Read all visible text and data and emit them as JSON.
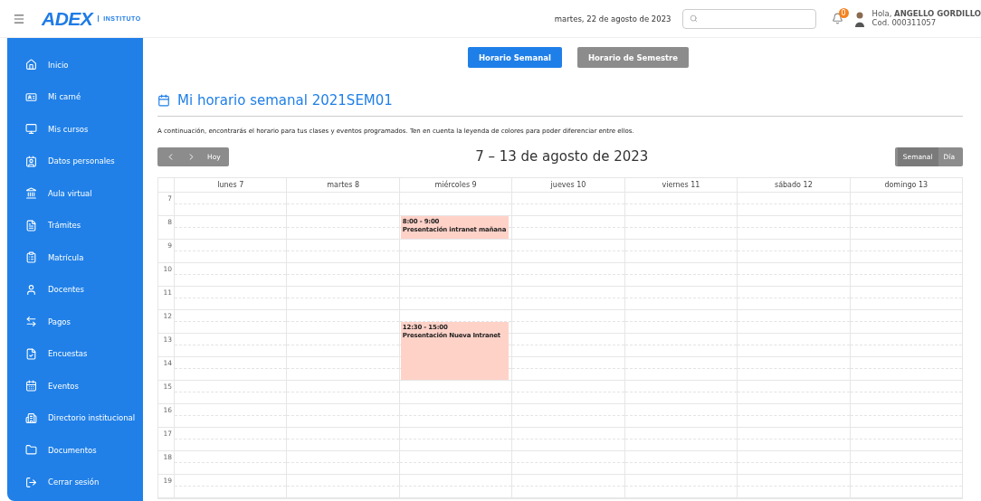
{
  "header": {
    "logo": "ADEX",
    "logo_sub": "INSTITUTO",
    "date": "martes, 22 de agosto de 2023",
    "notifications": {
      "badge": "0"
    },
    "user": {
      "greeting": "Hola, **ANGELLO GORDILLO**",
      "code": "Cod. 000311057"
    }
  },
  "sidebar": {
    "items": [
      {
        "label": "Inicio"
      },
      {
        "label": "Mi carné"
      },
      {
        "label": "Mis cursos"
      },
      {
        "label": "Datos personales"
      },
      {
        "label": "Aula virtual"
      },
      {
        "label": "Trámites"
      },
      {
        "label": "Matrícula"
      },
      {
        "label": "Docentes"
      },
      {
        "label": "Pagos"
      },
      {
        "label": "Encuestas"
      },
      {
        "label": "Eventos"
      },
      {
        "label": "Directorio institucional"
      },
      {
        "label": "Documentos"
      },
      {
        "label": "Cerrar sesión"
      }
    ]
  },
  "schedule_tabs": [
    {
      "label": "Horario Semanal",
      "selected": true
    },
    {
      "label": "Horario de Semestre",
      "selected": false
    }
  ],
  "title": "Mi horario semanal 2021SEM01",
  "description": "A continuación, encontrarás el horario para tus clases y eventos programados. Ten en cuenta la leyenda de colores para poder diferenciar entre ellos.",
  "calendar": {
    "today_button": "Hoy",
    "range": "7 – 13 de agosto de 2023",
    "views": [
      {
        "label": "Semanal",
        "selected": true
      },
      {
        "label": "Día",
        "selected": false
      }
    ],
    "days": [
      {
        "label": "lunes 7"
      },
      {
        "label": "martes 8"
      },
      {
        "label": "miércoles 9",
        "events": [
          {
            "time": "8:00 - 9:00",
            "title": "Presentación intranet mañana"
          },
          {
            "time": "12:30 - 15:00",
            "title": "Presentación Nueva Intranet"
          }
        ]
      },
      {
        "label": "jueves 10"
      },
      {
        "label": "viernes 11"
      },
      {
        "label": "sábado 12"
      },
      {
        "label": "domingo 13"
      }
    ],
    "hours": [
      "7",
      "8",
      "9",
      "10",
      "11",
      "12",
      "13",
      "14",
      "15",
      "16",
      "17",
      "18",
      "19"
    ]
  }
}
